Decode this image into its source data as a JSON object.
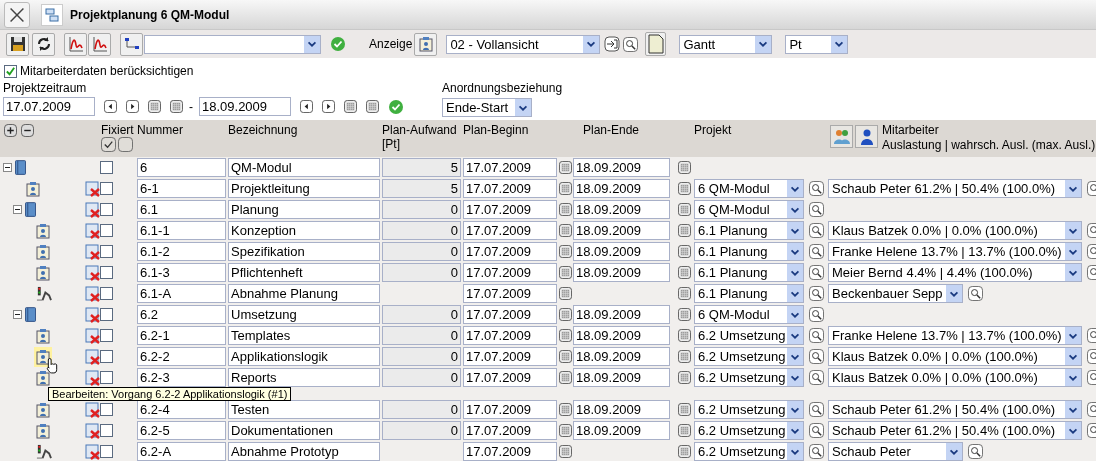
{
  "window": {
    "title": "Projektplanung 6 QM-Modul"
  },
  "toolbar": {
    "display_label": "Anzeige",
    "view_select": "02 - Vollansicht",
    "mode_select": "Gantt",
    "unit_select": "Pt"
  },
  "options": {
    "label": "Mitarbeiterdaten berücksichtigen",
    "checked": true
  },
  "period": {
    "label": "Projektzeitraum",
    "start": "17.07.2009",
    "separator": "-",
    "end": "18.09.2009"
  },
  "relation": {
    "label": "Anordnungsbeziehung",
    "value": "Ende-Start"
  },
  "table": {
    "columns": {
      "fixed": "Fixiert",
      "number": "Nummer",
      "name": "Bezeichnung",
      "effort": "Plan-Aufwand",
      "effort_unit": "[Pt]",
      "start": "Plan-Beginn",
      "end": "Plan-Ende",
      "project": "Projekt",
      "employee": "Mitarbeiter",
      "employee_sub": "Auslastung | wahrsch. Ausl. (max. Ausl.)"
    },
    "rows": [
      {
        "kind": "summary",
        "expanded": true,
        "deletable": false,
        "checked": false,
        "hovered": false,
        "number": "6",
        "name": "QM-Modul",
        "effort": "5",
        "start": "17.07.2009",
        "end": "18.09.2009",
        "children": [
          {
            "kind": "task",
            "deletable": true,
            "checked": false,
            "hovered": false,
            "number": "6-1",
            "name": "Projektleitung",
            "effort": "5",
            "start": "17.07.2009",
            "end": "18.09.2009",
            "project": "6 QM-Modul",
            "employee": "Schaub Peter 61.2% | 50.4% (100.0%)"
          },
          {
            "kind": "summary",
            "expanded": true,
            "deletable": true,
            "checked": false,
            "hovered": false,
            "number": "6.1",
            "name": "Planung",
            "effort": "0",
            "start": "17.07.2009",
            "end": "18.09.2009",
            "project": "6 QM-Modul",
            "children": [
              {
                "kind": "task",
                "deletable": true,
                "checked": false,
                "hovered": false,
                "number": "6.1-1",
                "name": "Konzeption",
                "effort": "0",
                "start": "17.07.2009",
                "end": "18.09.2009",
                "project": "6.1 Planung",
                "employee": "Klaus Batzek 0.0% | 0.0% (100.0%)"
              },
              {
                "kind": "task",
                "deletable": true,
                "checked": false,
                "hovered": false,
                "number": "6.1-2",
                "name": "Spezifikation",
                "effort": "0",
                "start": "17.07.2009",
                "end": "18.09.2009",
                "project": "6.1 Planung",
                "employee": "Franke Helene 13.7% | 13.7% (100.0%)"
              },
              {
                "kind": "task",
                "deletable": true,
                "checked": false,
                "hovered": false,
                "number": "6.1-3",
                "name": "Pflichtenheft",
                "effort": "0",
                "start": "17.07.2009",
                "end": "18.09.2009",
                "project": "6.1 Planung",
                "employee": "Meier Bernd 4.4% | 4.4% (100.0%)"
              },
              {
                "kind": "milestone",
                "deletable": true,
                "checked": false,
                "hovered": false,
                "number": "6.1-A",
                "name": "Abnahme Planung",
                "start": "17.07.2009",
                "project": "6.1 Planung",
                "employee": "Beckenbauer Sepp"
              }
            ]
          },
          {
            "kind": "summary",
            "expanded": true,
            "deletable": true,
            "checked": false,
            "hovered": false,
            "number": "6.2",
            "name": "Umsetzung",
            "effort": "0",
            "start": "17.07.2009",
            "end": "18.09.2009",
            "project": "6 QM-Modul",
            "children": [
              {
                "kind": "task",
                "deletable": true,
                "checked": false,
                "hovered": false,
                "number": "6.2-1",
                "name": "Templates",
                "effort": "0",
                "start": "17.07.2009",
                "end": "18.09.2009",
                "project": "6.2 Umsetzung",
                "employee": "Franke Helene 13.7% | 13.7% (100.0%)"
              },
              {
                "kind": "task",
                "deletable": true,
                "checked": false,
                "hovered": true,
                "tooltip": "Bearbeiten: Vorgang 6.2-2 Applikationslogik (#1)",
                "number": "6.2-2",
                "name": "Applikationslogik",
                "effort": "0",
                "start": "17.07.2009",
                "end": "18.09.2009",
                "project": "6.2 Umsetzung",
                "employee": "Klaus Batzek 0.0% | 0.0% (100.0%)"
              },
              {
                "kind": "task",
                "deletable": true,
                "checked": false,
                "hovered": false,
                "number": "6.2-3",
                "name": "Reports",
                "effort": "0",
                "start": "17.07.2009",
                "end": "18.09.2009",
                "project": "6.2 Umsetzung",
                "employee": "Klaus Batzek 0.0% | 0.0% (100.0%)"
              },
              {
                "kind": "task",
                "deletable": true,
                "checked": false,
                "hovered": false,
                "number": "6.2-4",
                "name": "Testen",
                "effort": "0",
                "start": "17.07.2009",
                "end": "18.09.2009",
                "project": "6.2 Umsetzung",
                "employee": "Schaub Peter 61.2% | 50.4% (100.0%)"
              },
              {
                "kind": "task",
                "deletable": true,
                "checked": false,
                "hovered": false,
                "number": "6.2-5",
                "name": "Dokumentationen",
                "effort": "0",
                "start": "17.07.2009",
                "end": "18.09.2009",
                "project": "6.2 Umsetzung",
                "employee": "Schaub Peter 61.2% | 50.4% (100.0%)"
              },
              {
                "kind": "milestone",
                "deletable": true,
                "checked": false,
                "hovered": false,
                "number": "6.2-A",
                "name": "Abnahme Prototyp",
                "start": "17.07.2009",
                "project": "6.2 Umsetzung",
                "employee": "Schaub Peter"
              }
            ]
          }
        ]
      }
    ]
  }
}
